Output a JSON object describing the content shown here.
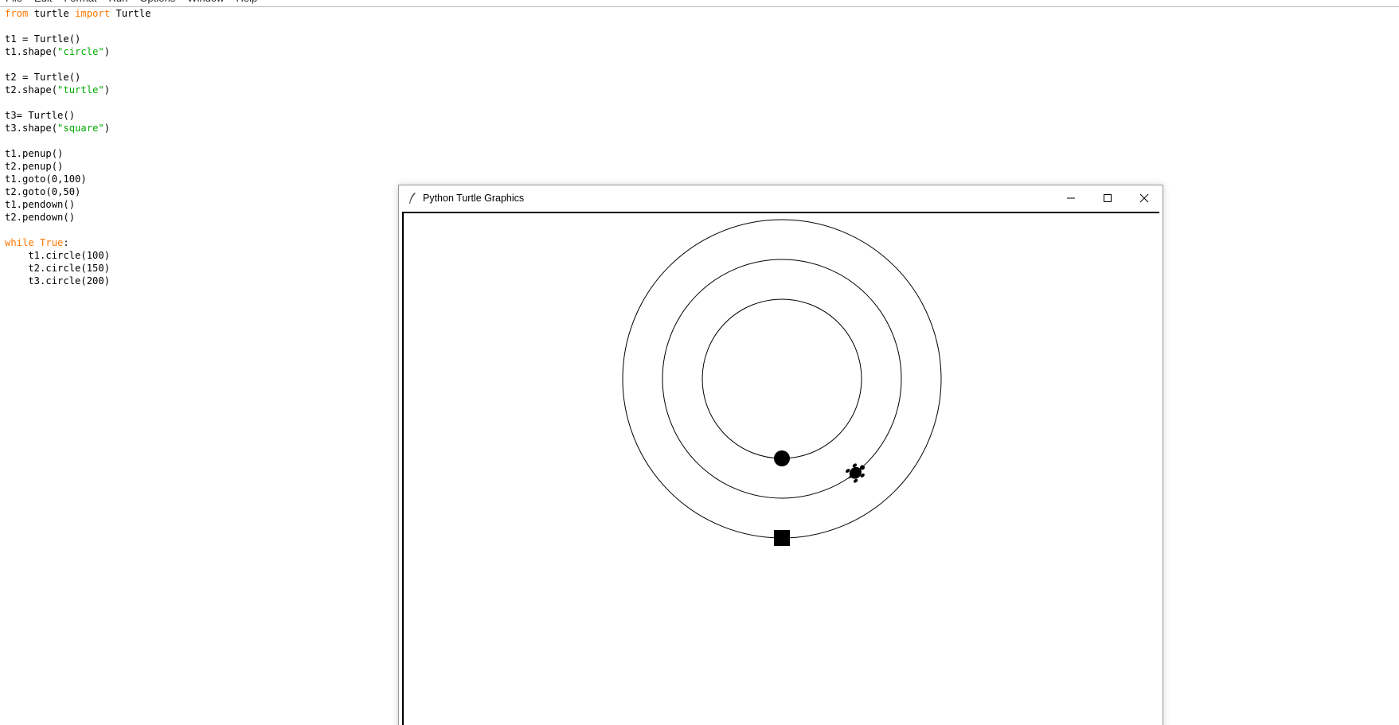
{
  "editor": {
    "menu": [
      {
        "label": "File"
      },
      {
        "label": "Edit"
      },
      {
        "label": "Format"
      },
      {
        "label": "Run"
      },
      {
        "label": "Options"
      },
      {
        "label": "Window"
      },
      {
        "label": "Help"
      }
    ],
    "lines": [
      [
        {
          "t": "from",
          "k": "kw"
        },
        {
          "t": " turtle ",
          "k": "plain"
        },
        {
          "t": "import",
          "k": "kw"
        },
        {
          "t": " Turtle",
          "k": "plain"
        }
      ],
      [],
      [
        {
          "t": "t1 = Turtle()",
          "k": "plain"
        }
      ],
      [
        {
          "t": "t1.shape(",
          "k": "plain"
        },
        {
          "t": "\"circle\"",
          "k": "str"
        },
        {
          "t": ")",
          "k": "plain"
        }
      ],
      [],
      [
        {
          "t": "t2 = Turtle()",
          "k": "plain"
        }
      ],
      [
        {
          "t": "t2.shape(",
          "k": "plain"
        },
        {
          "t": "\"turtle\"",
          "k": "str"
        },
        {
          "t": ")",
          "k": "plain"
        }
      ],
      [],
      [
        {
          "t": "t3= Turtle()",
          "k": "plain"
        }
      ],
      [
        {
          "t": "t3.shape(",
          "k": "plain"
        },
        {
          "t": "\"square\"",
          "k": "str"
        },
        {
          "t": ")",
          "k": "plain"
        }
      ],
      [],
      [
        {
          "t": "t1.penup()",
          "k": "plain"
        }
      ],
      [
        {
          "t": "t2.penup()",
          "k": "plain"
        }
      ],
      [
        {
          "t": "t1.goto(0,100)",
          "k": "plain"
        }
      ],
      [
        {
          "t": "t2.goto(0,50)",
          "k": "plain"
        }
      ],
      [
        {
          "t": "t1.pendown()",
          "k": "plain"
        }
      ],
      [
        {
          "t": "t2.pendown()",
          "k": "plain"
        }
      ],
      [],
      [
        {
          "t": "while",
          "k": "kw"
        },
        {
          "t": " ",
          "k": "plain"
        },
        {
          "t": "True",
          "k": "kw"
        },
        {
          "t": ":",
          "k": "plain"
        }
      ],
      [
        {
          "t": "    t1.circle(100)",
          "k": "plain"
        }
      ],
      [
        {
          "t": "    t2.circle(150)",
          "k": "plain"
        }
      ],
      [
        {
          "t": "    t3.circle(200)",
          "k": "plain"
        }
      ]
    ]
  },
  "turtle_window": {
    "title": "Python Turtle Graphics",
    "controls": [
      "minimize-icon",
      "maximize-icon",
      "close-icon"
    ],
    "circles": [
      {
        "turtle": "t1",
        "shape": "circle",
        "start": [
          0,
          100
        ],
        "radius": 100
      },
      {
        "turtle": "t2",
        "shape": "turtle",
        "start": [
          0,
          50
        ],
        "radius": 150
      },
      {
        "turtle": "t3",
        "shape": "square",
        "start": [
          0,
          0
        ],
        "radius": 200
      }
    ],
    "colors": {
      "pen": "#000000",
      "canvas": "#ffffff"
    }
  },
  "colors": {
    "keyword": "#ff7700",
    "string": "#00aa00",
    "text": "#000000"
  }
}
